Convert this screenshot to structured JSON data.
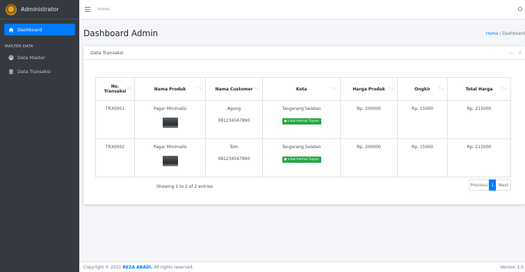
{
  "sidebar": {
    "brand": "Administrator",
    "dashboard_label": "Dashboard",
    "section_header": "MASTER DATA",
    "items": [
      {
        "label": "Data Master",
        "icon": "palette-icon"
      },
      {
        "label": "Data Transaksi",
        "icon": "database-icon"
      }
    ]
  },
  "topbar": {
    "home_link": "Home"
  },
  "header": {
    "title": "Dashboard Admin",
    "breadcrumb_home": "Home",
    "breadcrumb_sep": "/",
    "breadcrumb_current": "Dashboard"
  },
  "card": {
    "title": "Data Transaksi",
    "collapse": "—",
    "close": "✕"
  },
  "table": {
    "headers": {
      "no_line1": "No.",
      "no_line2": "Transaksi",
      "produk": "Nama Produk",
      "customer": "Nama Customer",
      "kota": "Kota",
      "harga": "Harga Produk",
      "ongkir": "Ongkir",
      "total": "Total Harga"
    },
    "rows": [
      {
        "no": "TRX0001",
        "produk": "Pagar Minimalis",
        "customer": "Agung",
        "phone": "081234567890",
        "kota": "Tangerang Selatan",
        "map_label": "Lihat Alamat Tujuan",
        "harga": "Rp. 200000",
        "ongkir": "Rp. 15000",
        "total": "Rp. 215000"
      },
      {
        "no": "TRX0002",
        "produk": "Pagar Minimalis",
        "customer": "Tom",
        "phone": "081234567890",
        "kota": "Tangerang Selatan",
        "map_label": "Lihat Alamat Tujuan",
        "harga": "Rp. 200000",
        "ongkir": "Rp. 15000",
        "total": "Rp. 215000"
      }
    ],
    "info": "Showing 1 to 2 of 2 entries",
    "pager": {
      "prev": "Previous",
      "page": "1",
      "next": "Next"
    }
  },
  "footer": {
    "prefix": "Copyright © 2021",
    "brand": "REZA ABADI.",
    "suffix": "All rights reserved.",
    "version": "Version 1.0"
  },
  "colors": {
    "sidebar_bg": "#343a40",
    "accent": "#007bff",
    "map_button": "#28a745"
  }
}
